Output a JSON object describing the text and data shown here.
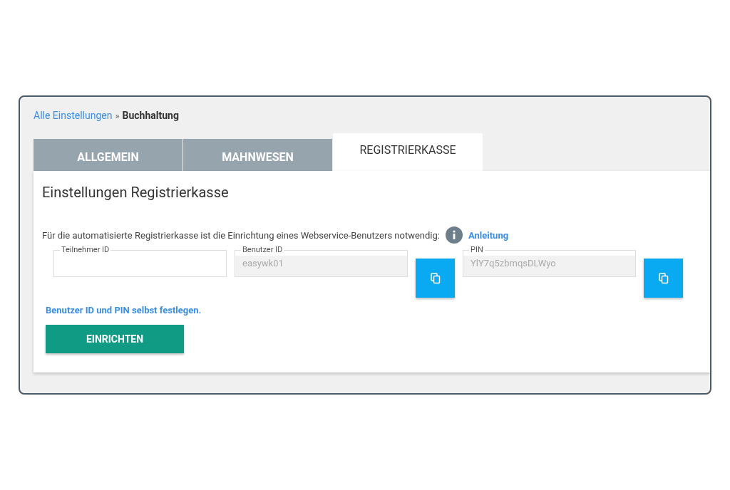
{
  "breadcrumb": {
    "link": "Alle Einstellungen",
    "separator": "»",
    "current": "Buchhaltung"
  },
  "tabs": [
    {
      "label": "ALLGEMEIN",
      "selected": false
    },
    {
      "label": "MAHNWESEN",
      "selected": false
    },
    {
      "label": "REGISTRIERKASSE",
      "selected": true
    }
  ],
  "panel": {
    "title": "Einstellungen Registrierkasse",
    "intro": "Für die automatisierte Registrierkasse ist die Einrichtung eines Webservice-Benutzers notwendig:",
    "help_link": "Anleitung",
    "fields": [
      {
        "label": "Teilnehmer ID",
        "disabled": false,
        "copyable": false
      },
      {
        "label": "Benutzer ID",
        "value": "easywk01",
        "disabled": true,
        "copyable": true
      },
      {
        "label": "PIN",
        "value": "YlY7q5zbmqsDLWyo",
        "disabled": true,
        "copyable": true
      }
    ],
    "custom_link": "Benutzer ID und PIN selbst festlegen.",
    "submit": "EINRICHTEN"
  }
}
